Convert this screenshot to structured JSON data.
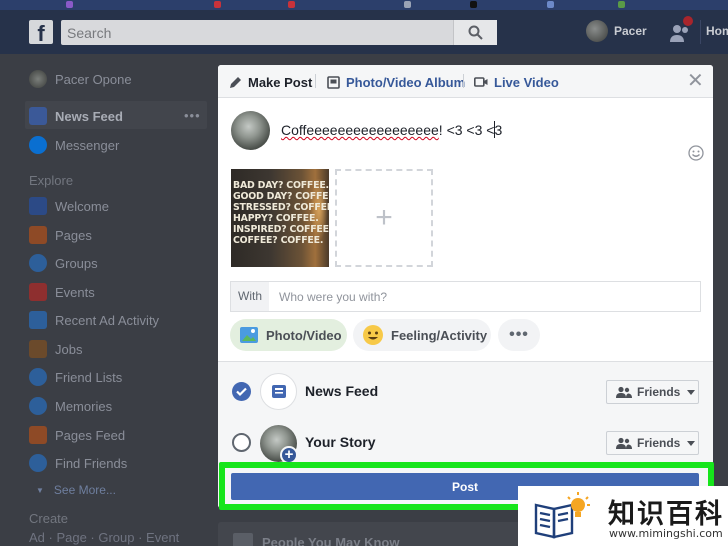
{
  "topbar": {
    "logo": "f",
    "search_placeholder": "Search",
    "user_name": "Pacer",
    "home_label": "Home"
  },
  "sidebar": {
    "profile_name": "Pacer Opone",
    "items_top": [
      {
        "label": "News Feed",
        "icon": "news-feed-icon",
        "color": "#3b5998"
      },
      {
        "label": "Messenger",
        "icon": "messenger-icon",
        "color": "#0084ff"
      }
    ],
    "explore_header": "Explore",
    "explore_items": [
      {
        "label": "Welcome",
        "icon": "facebook-icon",
        "color": "#3b5998"
      },
      {
        "label": "Pages",
        "icon": "flag-icon",
        "color": "#d0622b"
      },
      {
        "label": "Groups",
        "icon": "groups-icon",
        "color": "#3b79c5"
      },
      {
        "label": "Events",
        "icon": "calendar-icon",
        "color": "#c33a3a"
      },
      {
        "label": "Recent Ad Activity",
        "icon": "ad-activity-icon",
        "color": "#3b79c5"
      },
      {
        "label": "Jobs",
        "icon": "briefcase-icon",
        "color": "#8a5a2b"
      },
      {
        "label": "Friend Lists",
        "icon": "friend-lists-icon",
        "color": "#3b79c5"
      },
      {
        "label": "Memories",
        "icon": "memories-icon",
        "color": "#3b79c5"
      },
      {
        "label": "Pages Feed",
        "icon": "pages-feed-icon",
        "color": "#d0622b"
      },
      {
        "label": "Find Friends",
        "icon": "find-friends-icon",
        "color": "#3b79c5"
      }
    ],
    "see_more": "See More...",
    "create_header": "Create",
    "create_links": "Ad · Page · Group · Event"
  },
  "modal": {
    "tabs": [
      {
        "label": "Make Post",
        "icon": "pencil-icon"
      },
      {
        "label": "Photo/Video Album",
        "icon": "album-icon"
      },
      {
        "label": "Live Video",
        "icon": "video-camera-icon"
      }
    ],
    "composer_text_misspelled": "Coffeeeeeeeeeeeeeeeee",
    "composer_text_rest": "! <3 <3 <3",
    "coffee_image_lines": [
      "BAD DAY? COFFEE.",
      "GOOD DAY? COFFEE.",
      "STRESSED? COFFEE.",
      "HAPPY? COFFEE.",
      "INSPIRED? COFFEE.",
      "COFFEE? COFFEE."
    ],
    "add_photo_symbol": "+",
    "with_label": "With",
    "with_placeholder": "Who were you with?",
    "actions": [
      {
        "label": "Photo/Video",
        "icon": "photo-icon"
      },
      {
        "label": "Feeling/Activity",
        "icon": "smiley-icon"
      },
      {
        "label": "•••",
        "icon": "more-icon"
      }
    ],
    "share_targets": [
      {
        "label": "News Feed",
        "selected": true,
        "audience": "Friends"
      },
      {
        "label": "Your Story",
        "selected": false,
        "audience": "Friends"
      }
    ],
    "post_button": "Post",
    "highlight_color": "#16e51b"
  },
  "below": {
    "people_you_may_know": "People You May Know"
  },
  "watermark": {
    "title": "知识百科",
    "url": "www.mimingshi.com"
  }
}
